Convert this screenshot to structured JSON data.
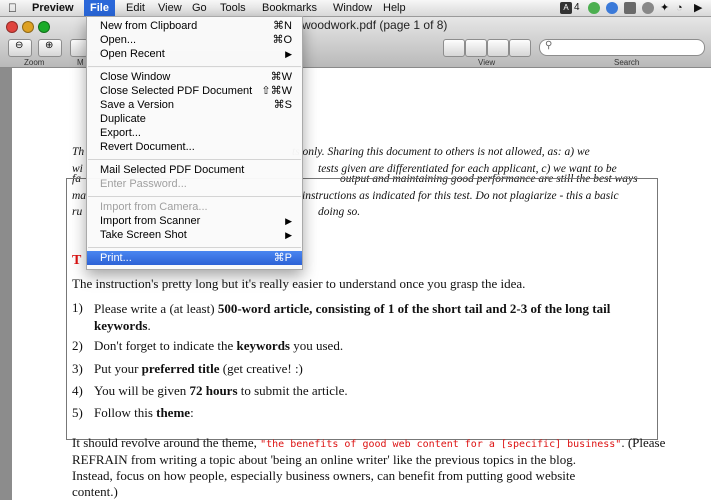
{
  "menubar": {
    "apple": "",
    "app": "Preview",
    "items": [
      "File",
      "Edit",
      "View",
      "Go",
      "Tools",
      "Bookmarks",
      "Window",
      "Help"
    ],
    "status": {
      "battery_num": "4"
    }
  },
  "window": {
    "title": "woodwork.pdf (page 1 of 8)",
    "toolbar": {
      "zoom": "Zoom",
      "move_label_fragment": "M",
      "view": "View",
      "search": "Search"
    }
  },
  "file_menu": {
    "items": [
      {
        "label": "New from Clipboard",
        "shortcut": "⌘N",
        "disabled": false,
        "submenu": false
      },
      {
        "label": "Open...",
        "shortcut": "⌘O",
        "disabled": false,
        "submenu": false
      },
      {
        "label": "Open Recent",
        "shortcut": "",
        "disabled": false,
        "submenu": true
      },
      {
        "label": "Close Window",
        "shortcut": "⌘W",
        "disabled": false,
        "submenu": false
      },
      {
        "label": "Close Selected PDF Document",
        "shortcut": "⇧⌘W",
        "disabled": false,
        "submenu": false
      },
      {
        "label": "Save a Version",
        "shortcut": "⌘S",
        "disabled": false,
        "submenu": false
      },
      {
        "label": "Duplicate",
        "shortcut": "",
        "disabled": false,
        "submenu": false
      },
      {
        "label": "Export...",
        "shortcut": "",
        "disabled": false,
        "submenu": false
      },
      {
        "label": "Revert Document...",
        "shortcut": "",
        "disabled": false,
        "submenu": false
      },
      {
        "label": "Mail Selected PDF Document",
        "shortcut": "",
        "disabled": false,
        "submenu": false
      },
      {
        "label": "Enter Password...",
        "shortcut": "",
        "disabled": true,
        "submenu": false
      },
      {
        "label": "Import from Camera...",
        "shortcut": "",
        "disabled": true,
        "submenu": false
      },
      {
        "label": "Import from Scanner",
        "shortcut": "",
        "disabled": false,
        "submenu": true
      },
      {
        "label": "Take Screen Shot",
        "shortcut": "",
        "disabled": false,
        "submenu": true
      },
      {
        "label": "Print...",
        "shortcut": "⌘P",
        "disabled": false,
        "submenu": false,
        "active": true
      }
    ]
  },
  "document": {
    "italic_lines": [
      "Th",
      "wi",
      "fa",
      "ma",
      "ru"
    ],
    "italic_right": [
      "ts only. Sharing this document to others is not allowed, as: a) we",
      "tests given are differentiated for each applicant, c) we want to be",
      "output and maintaining good performance are still the best ways",
      "instructions as indicated for this test. Do not plagiarize - this a basic",
      "doing so."
    ],
    "heading_fragment": "T",
    "intro": "The instruction's pretty long but it's really easier to understand once you grasp the idea.",
    "items": [
      {
        "num": "1)",
        "pre": "Please write a (at least) ",
        "bold": "500-word article, consisting of 1 of the short tail and 2-3 of the long tail keywords",
        "post": "."
      },
      {
        "num": "2)",
        "pre": "Don't forget to indicate the ",
        "bold": "keywords",
        "post": " you used."
      },
      {
        "num": "3)",
        "pre": "Put your ",
        "bold": "preferred title",
        "post": " (get creative! :)"
      },
      {
        "num": "4)",
        "pre": "You will be given ",
        "bold": "72 hours",
        "post": " to submit the article."
      },
      {
        "num": "5)",
        "pre": "Follow this ",
        "bold": "theme",
        "post": ":"
      }
    ],
    "theme_pre": "It should revolve around the theme, ",
    "theme_hand": "\"the benefits of good web content for a [specific] business\"",
    "theme_post": ". (Please",
    "para_lines": [
      "REFRAIN from writing a topic about 'being an online writer' like the previous topics in the blog.",
      "Instead, focus on how people, especially business owners, can benefit from putting good website",
      "content.)"
    ]
  },
  "colors": {
    "menu_highlight": "#2d62d6",
    "red": "#dd1111"
  }
}
